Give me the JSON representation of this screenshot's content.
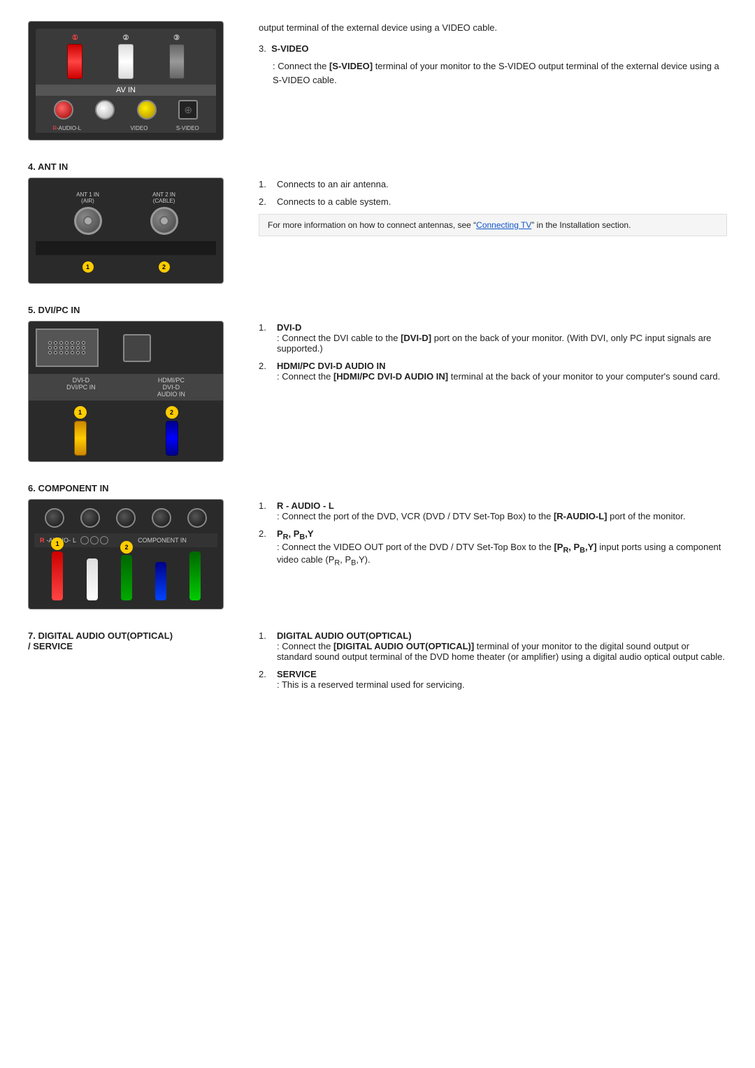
{
  "sections": {
    "top_text": "output terminal of the external device using a VIDEO cable.",
    "svideo_section": {
      "number": "3.",
      "title": "S-VIDEO",
      "desc": ": Connect the [S-VIDEO] terminal of your monitor to the S-VIDEO output terminal of the external device using a S-VIDEO cable.",
      "bold_part": "[S-VIDEO]"
    },
    "ant_in": {
      "title": "4. ANT IN",
      "item1_num": "1.",
      "item1": "Connects to an air antenna.",
      "item2_num": "2.",
      "item2": "Connects to a cable system.",
      "note": "For more information on how to connect antennas, see \"Connecting TV\" in the Installation section.",
      "note_link": "Connecting TV",
      "ant1_label": "ANT 1 IN\n(AIR)",
      "ant2_label": "ANT 2 IN\n(CABLE)"
    },
    "dvi_pc_in": {
      "title": "5. DVI/PC IN",
      "item1_num": "1.",
      "item1_title": "DVI-D",
      "item1_desc": ": Connect the DVI cable to the [DVI-D] port on the back of your monitor. (With DVI, only PC input signals are supported.)",
      "item1_bold": "[DVI-D]",
      "item2_num": "2.",
      "item2_title": "HDMI/PC DVI-D AUDIO IN",
      "item2_desc": ": Connect the [HDMI/PC DVI-D AUDIO IN] terminal at the back of your monitor to your computer's sound card.",
      "item2_bold": "[HDMI/PC DVI-D AUDIO IN]",
      "label_dvi_d": "DVI-D",
      "label_dvi_pc_in": "DVI/PC IN",
      "label_hdmi": "HDMI/PC\nDVI-D\nAUDIO IN"
    },
    "component_in": {
      "title": "6. COMPONENT IN",
      "item1_num": "1.",
      "item1_title": "R - AUDIO - L",
      "item1_desc": ": Connect the port of the DVD, VCR (DVD / DTV Set-Top Box) to the [R-AUDIO-L] port of the monitor.",
      "item1_bold": "[R-AUDIO-L]",
      "item2_num": "2.",
      "item2_title": "PR, PB,Y",
      "item2_desc": ": Connect the VIDEO OUT port of the DVD / DTV Set-Top Box to the [PR, PB,Y] input ports using a component video cable (PR, PB,Y).",
      "item2_bold1": "[PR, PB,Y]",
      "item2_bold2": "PR,"
    },
    "digital_audio": {
      "title": "7. DIGITAL AUDIO OUT(OPTICAL)\n/ SERVICE",
      "item1_num": "1.",
      "item1_title": "DIGITAL AUDIO OUT(OPTICAL)",
      "item1_desc": ": Connect the [DIGITAL AUDIO OUT(OPTICAL)] terminal of your monitor to the digital sound output or standard sound output terminal of the DVD home theater (or amplifier) using a digital audio optical output cable.",
      "item1_bold": "[DIGITAL AUDIO OUT(OPTICAL)]",
      "item2_num": "2.",
      "item2_title": "SERVICE",
      "item2_desc": ": This is a reserved terminal used for servicing."
    }
  },
  "colors": {
    "link": "#1155cc",
    "highlight": "#f5f5f5"
  }
}
